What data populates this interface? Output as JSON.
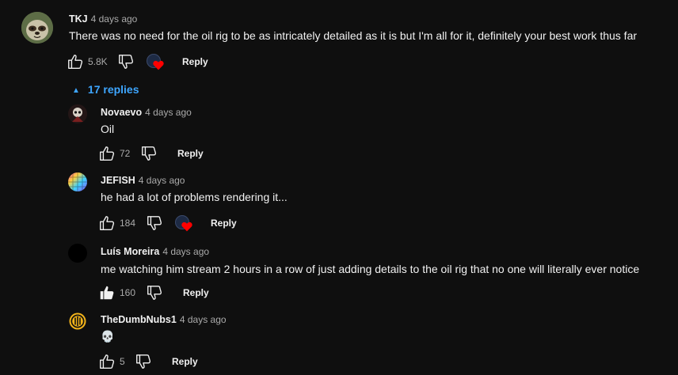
{
  "comment": {
    "author": "TKJ",
    "time": "4 days ago",
    "text": "There was no need for the oil rig to be as intricately detailed as it is but I'm all for it, definitely your best work thus far",
    "likes": "5.8K",
    "reply_label": "Reply",
    "hearted": true
  },
  "replies_toggle": {
    "arrow": "▲",
    "label": "17 replies"
  },
  "replies": [
    {
      "author": "Novaevo",
      "time": "4 days ago",
      "text": "Oil",
      "likes": "72",
      "reply_label": "Reply",
      "hearted": false,
      "liked": false
    },
    {
      "author": "JEFISH",
      "time": "4 days ago",
      "text": "he had a lot of problems rendering it...",
      "likes": "184",
      "reply_label": "Reply",
      "hearted": true,
      "liked": false
    },
    {
      "author": "Luís Moreira",
      "time": "4 days ago",
      "text": "me watching him stream 2 hours in a row of just adding details to the oil rig that no one will literally ever notice",
      "likes": "160",
      "reply_label": "Reply",
      "hearted": false,
      "liked": true
    },
    {
      "author": "TheDumbNubs1",
      "time": "4 days ago",
      "text": "💀",
      "likes": "5",
      "reply_label": "Reply",
      "hearted": false,
      "liked": false
    }
  ],
  "colors": {
    "link": "#3ea6ff",
    "heart": "#ff0000",
    "text": "#f1f1f1",
    "muted": "#aaaaaa"
  }
}
